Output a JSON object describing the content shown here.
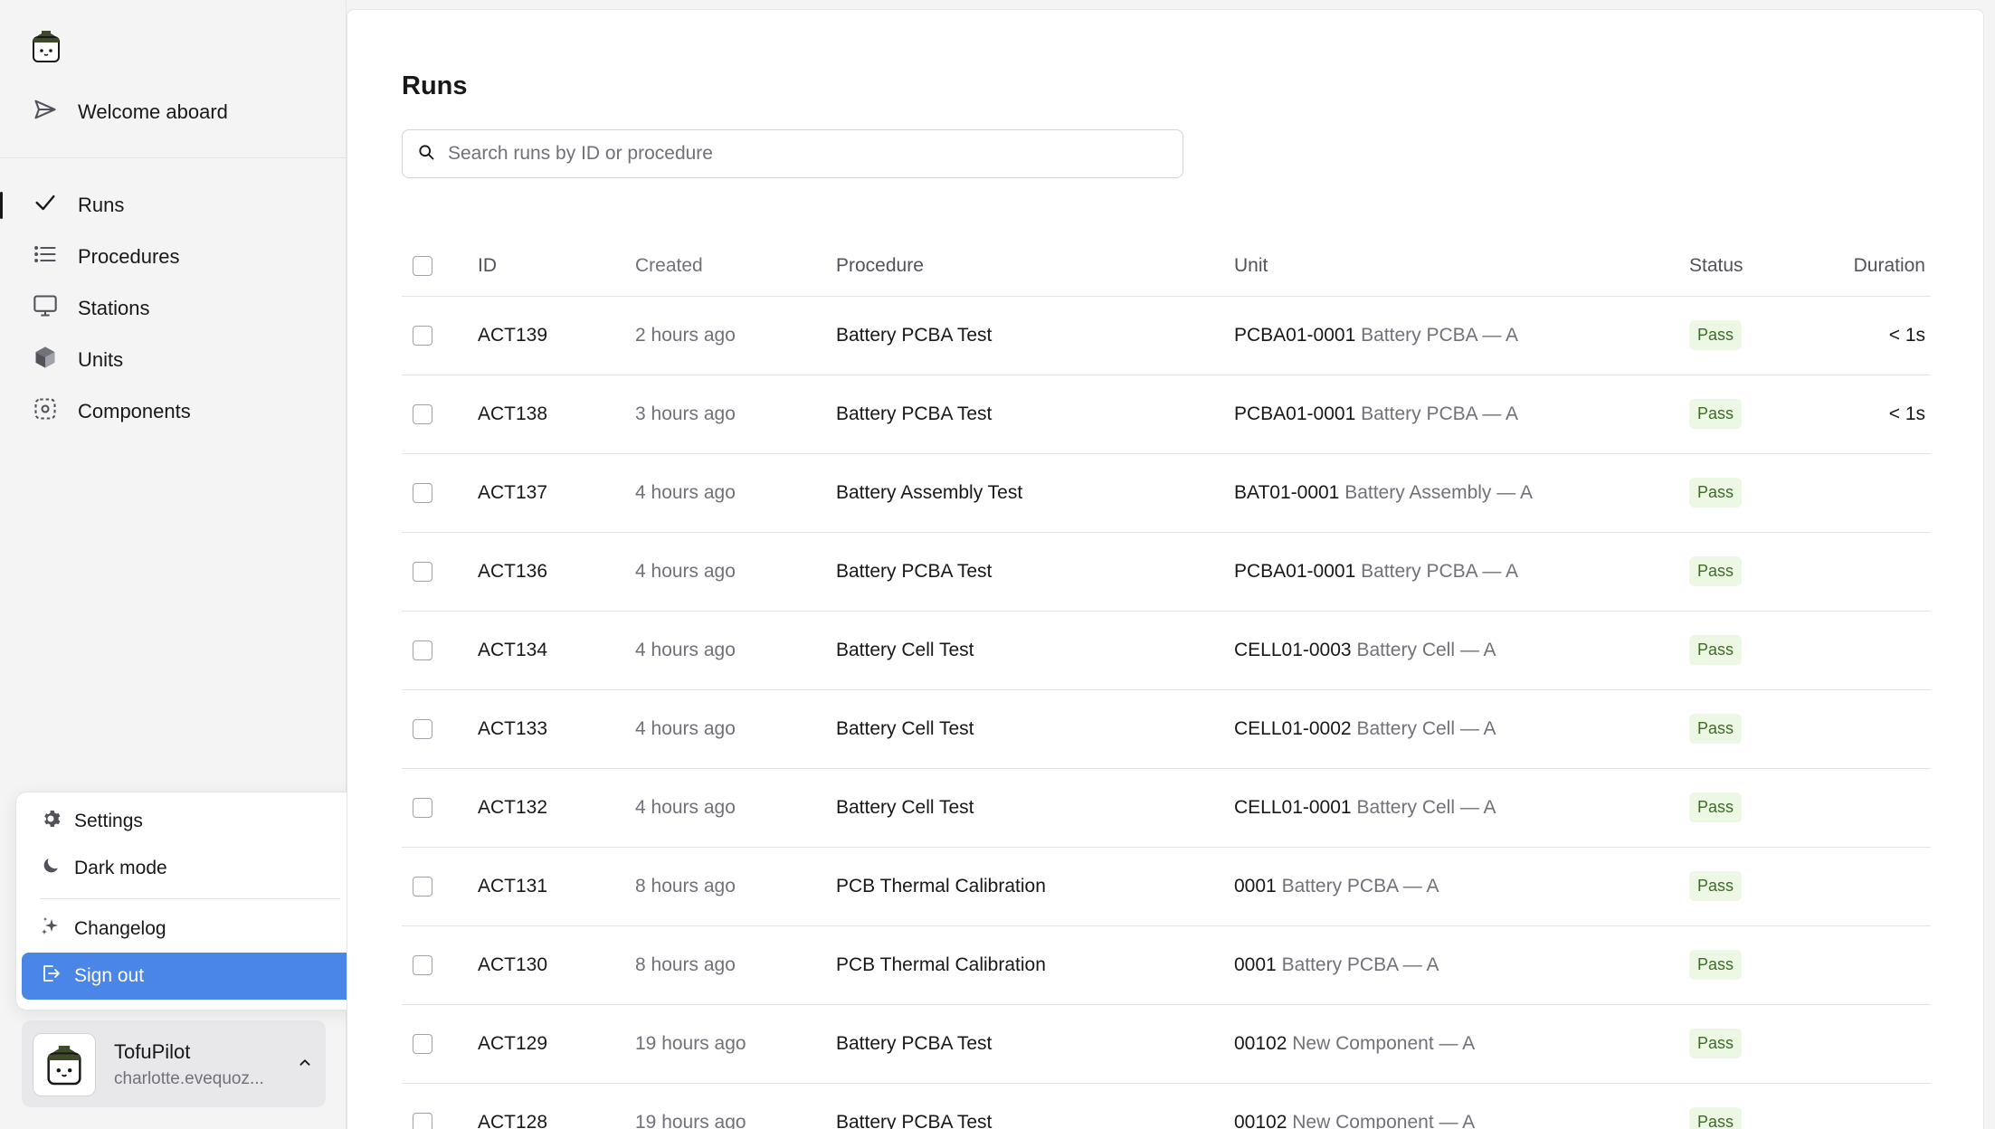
{
  "sidebar": {
    "welcome_label": "Welcome aboard",
    "nav": [
      {
        "label": "Runs",
        "icon": "check-icon",
        "active": true
      },
      {
        "label": "Procedures",
        "icon": "list-icon"
      },
      {
        "label": "Stations",
        "icon": "monitor-icon"
      },
      {
        "label": "Units",
        "icon": "cube-icon"
      },
      {
        "label": "Components",
        "icon": "component-icon"
      }
    ]
  },
  "menu": {
    "settings_label": "Settings",
    "dark_mode_label": "Dark mode",
    "changelog_label": "Changelog",
    "sign_out_label": "Sign out",
    "selected_color": "#4a86e8"
  },
  "account": {
    "name": "TofuPilot",
    "email": "charlotte.evequoz..."
  },
  "main": {
    "title": "Runs",
    "search_placeholder": "Search runs by ID or procedure",
    "columns": {
      "id": "ID",
      "created": "Created",
      "procedure": "Procedure",
      "unit": "Unit",
      "status": "Status",
      "duration": "Duration"
    },
    "rows": [
      {
        "id": "ACT139",
        "created": "2 hours ago",
        "procedure": "Battery PCBA Test",
        "unit_id": "PCBA01-0001",
        "unit_desc": "Battery PCBA — A",
        "status": "Pass",
        "duration": "< 1s"
      },
      {
        "id": "ACT138",
        "created": "3 hours ago",
        "procedure": "Battery PCBA Test",
        "unit_id": "PCBA01-0001",
        "unit_desc": "Battery PCBA — A",
        "status": "Pass",
        "duration": "< 1s"
      },
      {
        "id": "ACT137",
        "created": "4 hours ago",
        "procedure": "Battery Assembly Test",
        "unit_id": "BAT01-0001",
        "unit_desc": "Battery Assembly — A",
        "status": "Pass",
        "duration": ""
      },
      {
        "id": "ACT136",
        "created": "4 hours ago",
        "procedure": "Battery PCBA Test",
        "unit_id": "PCBA01-0001",
        "unit_desc": "Battery PCBA — A",
        "status": "Pass",
        "duration": ""
      },
      {
        "id": "ACT134",
        "created": "4 hours ago",
        "procedure": "Battery Cell Test",
        "unit_id": "CELL01-0003",
        "unit_desc": "Battery Cell — A",
        "status": "Pass",
        "duration": ""
      },
      {
        "id": "ACT133",
        "created": "4 hours ago",
        "procedure": "Battery Cell Test",
        "unit_id": "CELL01-0002",
        "unit_desc": "Battery Cell — A",
        "status": "Pass",
        "duration": ""
      },
      {
        "id": "ACT132",
        "created": "4 hours ago",
        "procedure": "Battery Cell Test",
        "unit_id": "CELL01-0001",
        "unit_desc": "Battery Cell — A",
        "status": "Pass",
        "duration": ""
      },
      {
        "id": "ACT131",
        "created": "8 hours ago",
        "procedure": "PCB Thermal Calibration",
        "unit_id": "0001",
        "unit_desc": "Battery PCBA — A",
        "status": "Pass",
        "duration": ""
      },
      {
        "id": "ACT130",
        "created": "8 hours ago",
        "procedure": "PCB Thermal Calibration",
        "unit_id": "0001",
        "unit_desc": "Battery PCBA — A",
        "status": "Pass",
        "duration": ""
      },
      {
        "id": "ACT129",
        "created": "19 hours ago",
        "procedure": "Battery PCBA Test",
        "unit_id": "00102",
        "unit_desc": "New Component — A",
        "status": "Pass",
        "duration": ""
      },
      {
        "id": "ACT128",
        "created": "19 hours ago",
        "procedure": "Battery PCBA Test",
        "unit_id": "00102",
        "unit_desc": "New Component — A",
        "status": "Pass",
        "duration": ""
      }
    ]
  }
}
